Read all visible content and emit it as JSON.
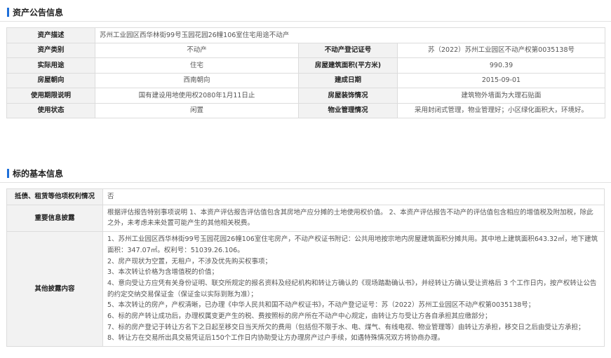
{
  "sections": {
    "asset_title": "资产公告信息",
    "basic_title": "标的基本信息"
  },
  "asset": {
    "desc_label": "资产描述",
    "desc_value": "苏州工业园区西华林街99号玉园花园26幢106室住宅用途不动产",
    "rows": [
      {
        "l1": "资产类别",
        "v1": "不动产",
        "l2": "不动产登记证号",
        "v2": "苏（2022）苏州工业园区不动产权第0035138号"
      },
      {
        "l1": "实际用途",
        "v1": "住宅",
        "l2": "房屋建筑面积(平方米)",
        "v2": "990.39"
      },
      {
        "l1": "房屋朝向",
        "v1": "西南朝向",
        "l2": "建成日期",
        "v2": "2015-09-01"
      },
      {
        "l1": "使用期限说明",
        "v1": "国有建设用地使用权2080年1月11日止",
        "l2": "房屋装饰情况",
        "v2": "建筑物外墙面为大理石贴面"
      },
      {
        "l1": "使用状态",
        "v1": "闲置",
        "l2": "物业管理情况",
        "v2": "采用封闭式管理，物业管理好；小区绿化面积大，环境好。"
      }
    ]
  },
  "basic": {
    "mortgage_label": "抵债、租赁等他项权利情况",
    "mortgage_value": "否",
    "important_label": "重要信息披露",
    "important_value": "根据评估报告特别事项说明 1、本资产评估报告评估值包含其房地产应分摊的土地使用权价值。 2、本资产评估报告不动产的评估值包含相应的增值税及附加税，除此之外，未考虑未来处置可能产生的其他相关税费。",
    "other_label": "其他披露内容",
    "other_lines": [
      "1、苏州工业园区西华林街99号玉园花园26幢106室住宅房产，不动产权证书附记：公共用地按宗地内房屋建筑面积分摊共用。其中地上建筑面积643.32㎡，地下建筑面积：347.07㎡。权利号：51039.26.106。",
      "2、房产现状为空置，无租户，不涉及优先购买权事项；",
      "3、本次转让价格为含增值税的价值；",
      "4、意向受让方应凭有关身份证明、联交所规定的报名资料及经纪机构和转让方确认的《现场踏勘确认书》，并经转让方确认受让资格后 3 个工作日内，按产权转让公告的约定交纳交易保证金（保证金以实际到账为准）；",
      "5、本次转让的房产，产权清晰，已办理《中华人民共和国不动产权证书》，不动产登记证号：苏（2022）苏州工业园区不动产权第0035138号；",
      "6、标的房产转让成功后，办理权属变更产生的税、费按照标的房产所在不动产中心规定，由转让方与受让方各自承担其应缴部分；",
      "7、标的房产登记于转让方名下之日起至移交日当天所欠的费用（包括但不限于水、电、煤气、有线电视、物业管理等）由转让方承担，移交日之后由受让方承担；",
      "8、转让方在交易所出具交易凭证后150个工作日内协助受让方办理房产过户手续，如遇特殊情况双方将协商办理。"
    ]
  }
}
